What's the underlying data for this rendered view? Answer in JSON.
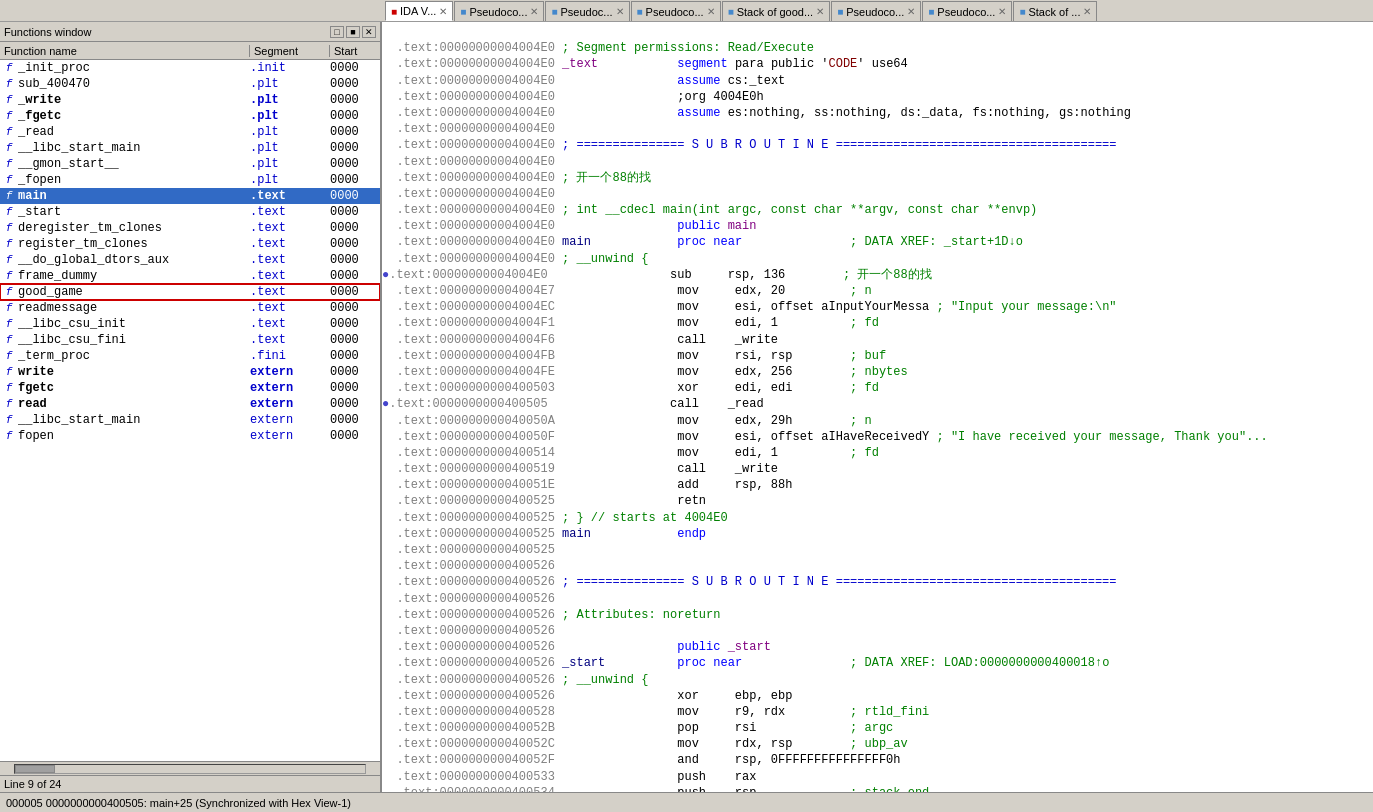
{
  "title": "Functions window",
  "tabs": [
    {
      "label": "IDA V...",
      "active": true,
      "closable": true
    },
    {
      "label": "Pseudoco...",
      "active": false,
      "closable": true
    },
    {
      "label": "Pseudoc...",
      "active": false,
      "closable": true
    },
    {
      "label": "Pseudoco...",
      "active": false,
      "closable": true
    },
    {
      "label": "Stack of good...",
      "active": false,
      "closable": true
    },
    {
      "label": "Pseudoco...",
      "active": false,
      "closable": true
    },
    {
      "label": "Pseudoco...",
      "active": false,
      "closable": true
    },
    {
      "label": "Stack of ...",
      "active": false,
      "closable": true
    }
  ],
  "functions_panel": {
    "title": "Functions window",
    "columns": [
      "Function name",
      "Segment",
      "Start"
    ],
    "rows": [
      {
        "icon": "f",
        "name": "_init_proc",
        "segment": ".init",
        "start": "0000",
        "bold": false
      },
      {
        "icon": "f",
        "name": "sub_400470",
        "segment": ".plt",
        "start": "0000",
        "bold": false
      },
      {
        "icon": "f",
        "name": "_write",
        "segment": ".plt",
        "start": "0000",
        "bold": true
      },
      {
        "icon": "f",
        "name": "_fgetc",
        "segment": ".plt",
        "start": "0000",
        "bold": true
      },
      {
        "icon": "f",
        "name": "_read",
        "segment": ".plt",
        "start": "0000",
        "bold": false
      },
      {
        "icon": "f",
        "name": "__libc_start_main",
        "segment": ".plt",
        "start": "0000",
        "bold": false
      },
      {
        "icon": "f",
        "name": "__gmon_start__",
        "segment": ".plt",
        "start": "0000",
        "bold": false
      },
      {
        "icon": "f",
        "name": "_fopen",
        "segment": ".plt",
        "start": "0000",
        "bold": false
      },
      {
        "icon": "f",
        "name": "main",
        "segment": ".text",
        "start": "0000",
        "bold": true
      },
      {
        "icon": "f",
        "name": "_start",
        "segment": ".text",
        "start": "0000",
        "bold": false
      },
      {
        "icon": "f",
        "name": "deregister_tm_clones",
        "segment": ".text",
        "start": "0000",
        "bold": false
      },
      {
        "icon": "f",
        "name": "register_tm_clones",
        "segment": ".text",
        "start": "0000",
        "bold": false
      },
      {
        "icon": "f",
        "name": "__do_global_dtors_aux",
        "segment": ".text",
        "start": "0000",
        "bold": false
      },
      {
        "icon": "f",
        "name": "frame_dummy",
        "segment": ".text",
        "start": "0000",
        "bold": false
      },
      {
        "icon": "f",
        "name": "good_game",
        "segment": ".text",
        "start": "0000",
        "bold": false,
        "selected": true
      },
      {
        "icon": "f",
        "name": "readmessage",
        "segment": ".text",
        "start": "0000",
        "bold": false
      },
      {
        "icon": "f",
        "name": "__libc_csu_init",
        "segment": ".text",
        "start": "0000",
        "bold": false
      },
      {
        "icon": "f",
        "name": "__libc_csu_fini",
        "segment": ".text",
        "start": "0000",
        "bold": false
      },
      {
        "icon": "f",
        "name": "_term_proc",
        "segment": ".fini",
        "start": "0000",
        "bold": false
      },
      {
        "icon": "f",
        "name": "write",
        "segment": "extern",
        "start": "0000",
        "bold": true
      },
      {
        "icon": "f",
        "name": "fgetc",
        "segment": "extern",
        "start": "0000",
        "bold": true
      },
      {
        "icon": "f",
        "name": "read",
        "segment": "extern",
        "start": "0000",
        "bold": true
      },
      {
        "icon": "f",
        "name": "__libc_start_main",
        "segment": "extern",
        "start": "0000",
        "bold": false
      },
      {
        "icon": "f",
        "name": "fopen",
        "segment": "extern",
        "start": "0000",
        "bold": false
      }
    ],
    "footer": "Line 9 of 24"
  },
  "status_bar": "000005 0000000000400505: main+25 (Synchronized with Hex View-1)",
  "code": "CODE"
}
